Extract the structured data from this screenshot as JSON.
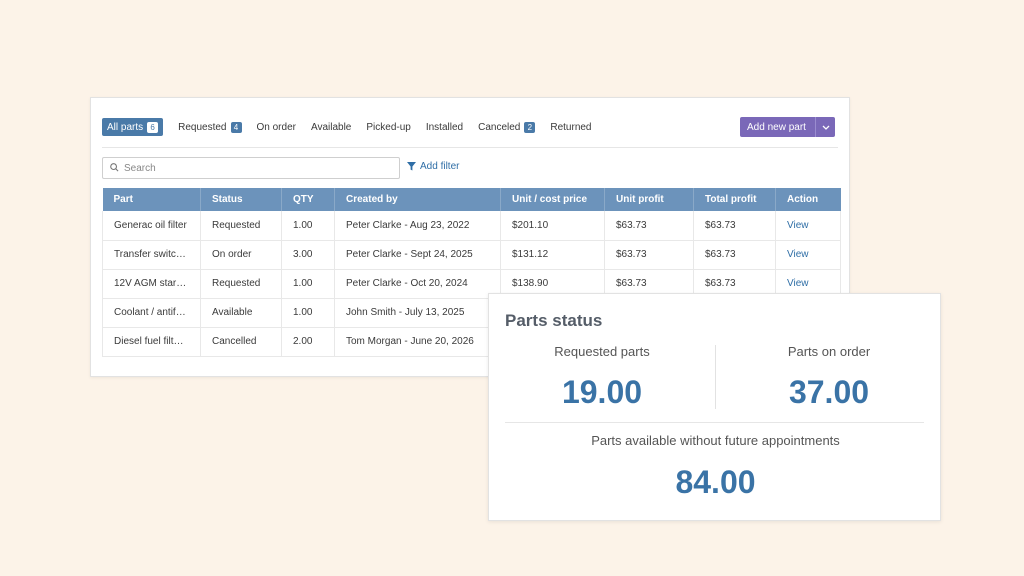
{
  "tabs": [
    {
      "label": "All parts",
      "badge": "6"
    },
    {
      "label": "Requested",
      "badge": "4"
    },
    {
      "label": "On order",
      "badge": null
    },
    {
      "label": "Available",
      "badge": null
    },
    {
      "label": "Picked-up",
      "badge": null
    },
    {
      "label": "Installed",
      "badge": null
    },
    {
      "label": "Canceled",
      "badge": "2"
    },
    {
      "label": "Returned",
      "badge": null
    }
  ],
  "add_part_button": "Add new part",
  "search": {
    "placeholder": "Search",
    "value": ""
  },
  "add_filter": "Add filter",
  "table": {
    "columns": [
      "Part",
      "Status",
      "QTY",
      "Created by",
      "Unit / cost price",
      "Unit profit",
      "Total profit",
      "Action"
    ],
    "rows": [
      [
        "Generac oil filter",
        "Requested",
        "1.00",
        "Peter Clarke - Aug 23, 2022",
        "$201.10",
        "$63.73",
        "$63.73",
        "View"
      ],
      [
        "Transfer switc…",
        "On order",
        "3.00",
        "Peter Clarke - Sept 24, 2025",
        "$131.12",
        "$63.73",
        "$63.73",
        "View"
      ],
      [
        "12V AGM starti…",
        "Requested",
        "1.00",
        "Peter Clarke - Oct 20, 2024",
        "$138.90",
        "$63.73",
        "$63.73",
        "View"
      ],
      [
        "Coolant / antifr…",
        "Available",
        "1.00",
        "John Smith - July 13, 2025",
        "",
        "",
        "",
        ""
      ],
      [
        "Diesel fuel filte…",
        "Cancelled",
        "2.00",
        "Tom Morgan - June 20, 2026",
        "",
        "",
        "",
        ""
      ]
    ]
  },
  "parts_status": {
    "title": "Parts status",
    "requested_label": "Requested parts",
    "requested_value": "19.00",
    "on_order_label": "Parts on order",
    "on_order_value": "37.00",
    "available_label": "Parts available without future appointments",
    "available_value": "84.00"
  },
  "colors": {
    "background": "#fcf3e8",
    "table_header": "#6c93bb",
    "active_tab": "#4a7aa8",
    "add_button": "#7a68b8",
    "link": "#2f6ea6",
    "stat_value": "#3a73a6"
  }
}
